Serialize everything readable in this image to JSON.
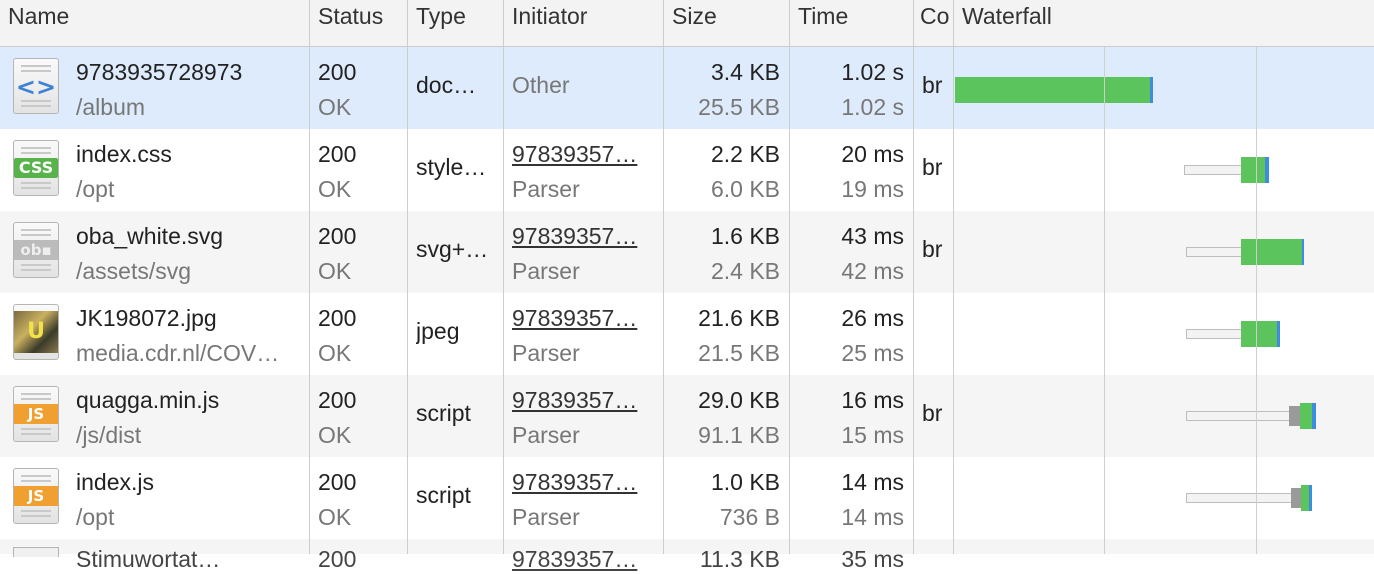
{
  "columns": {
    "name": "Name",
    "status": "Status",
    "type": "Type",
    "initiator": "Initiator",
    "size": "Size",
    "time": "Time",
    "connection": "Co",
    "waterfall": "Waterfall"
  },
  "rows": [
    {
      "icon": "html-document-icon",
      "glyph": "<>",
      "name": "9783935728973",
      "path": "/album",
      "status": "200",
      "status_text": "OK",
      "type": "doc…",
      "initiator": "Other",
      "initiator_sub": "",
      "size": "3.4 KB",
      "size_sub": "25.5 KB",
      "time": "1.02 s",
      "time_sub": "1.02 s",
      "conn": "br"
    },
    {
      "icon": "css-file-icon",
      "glyph": "CSS",
      "name": "index.css",
      "path": "/opt",
      "status": "200",
      "status_text": "OK",
      "type": "style…",
      "initiator": "97839357…",
      "initiator_sub": "Parser",
      "size": "2.2 KB",
      "size_sub": "6.0 KB",
      "time": "20 ms",
      "time_sub": "19 ms",
      "conn": "br"
    },
    {
      "icon": "svg-file-icon",
      "glyph": "ob▪",
      "name": "oba_white.svg",
      "path": "/assets/svg",
      "status": "200",
      "status_text": "OK",
      "type": "svg+…",
      "initiator": "97839357…",
      "initiator_sub": "Parser",
      "size": "1.6 KB",
      "size_sub": "2.4 KB",
      "time": "43 ms",
      "time_sub": "42 ms",
      "conn": "br"
    },
    {
      "icon": "image-thumbnail-icon",
      "glyph": "U",
      "name": "JK198072.jpg",
      "path": "media.cdr.nl/COV…",
      "status": "200",
      "status_text": "OK",
      "type": "jpeg",
      "initiator": "97839357…",
      "initiator_sub": "Parser",
      "size": "21.6 KB",
      "size_sub": "21.5 KB",
      "time": "26 ms",
      "time_sub": "25 ms",
      "conn": ""
    },
    {
      "icon": "js-file-icon",
      "glyph": "JS",
      "name": "quagga.min.js",
      "path": "/js/dist",
      "status": "200",
      "status_text": "OK",
      "type": "script",
      "initiator": "97839357…",
      "initiator_sub": "Parser",
      "size": "29.0 KB",
      "size_sub": "91.1 KB",
      "time": "16 ms",
      "time_sub": "15 ms",
      "conn": "br"
    },
    {
      "icon": "js-file-icon",
      "glyph": "JS",
      "name": "index.js",
      "path": "/opt",
      "status": "200",
      "status_text": "OK",
      "type": "script",
      "initiator": "97839357…",
      "initiator_sub": "Parser",
      "size": "1.0 KB",
      "size_sub": "736 B",
      "time": "14 ms",
      "time_sub": "14 ms",
      "conn": ""
    }
  ],
  "partial_row": {
    "name": "Stimuwortat…",
    "status": "200",
    "initiator": "97839357…",
    "size": "11.3 KB",
    "time": "35 ms"
  },
  "colors": {
    "selected_row": "#deebfc",
    "waterfall_receiving": "#5cc45c",
    "waterfall_download_end": "#3d8ce0",
    "domcontentloaded_line": "#3d6fd6",
    "load_line": "#d9443a"
  }
}
